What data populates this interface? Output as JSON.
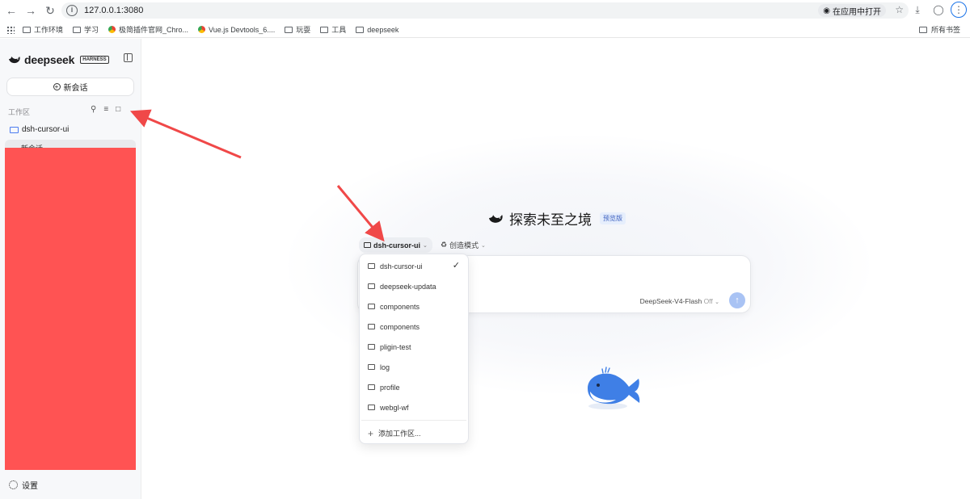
{
  "browser": {
    "url": "127.0.0.1:3080",
    "open_in_app": "在应用中打开",
    "bookmarks": [
      {
        "label": "工作环境",
        "icon": "folder-icon"
      },
      {
        "label": "学习",
        "icon": "folder-icon"
      },
      {
        "label": "极简插件官网_Chro...",
        "icon": "chrome-icon"
      },
      {
        "label": "Vue.js Devtools_6....",
        "icon": "chrome-icon"
      },
      {
        "label": "玩耍",
        "icon": "folder-icon"
      },
      {
        "label": "工具",
        "icon": "folder-icon"
      },
      {
        "label": "deepseek",
        "icon": "folder-icon"
      }
    ],
    "all_bookmarks": "所有书签"
  },
  "sidebar": {
    "logo_text": "deepseek",
    "logo_badge": "HARNESS",
    "new_chat": "新会话",
    "workspace_label": "工作区",
    "project": "dsh-cursor-ui",
    "thread": "新会话",
    "settings": "设置"
  },
  "main": {
    "headline": "探索未至之境",
    "beta_badge": "预览版",
    "workspace_chip": "dsh-cursor-ui",
    "mode_chip": "创造模式",
    "model": "DeepSeek-V4-Flash",
    "model_state": "Off",
    "send_icon": "arrow-up-icon"
  },
  "dropdown": {
    "items": [
      "dsh-cursor-ui",
      "deepseek-updata",
      "components",
      "components",
      "pligin-test",
      "log",
      "profile",
      "webgl-wf"
    ],
    "selected": "dsh-cursor-ui",
    "add_label": "添加工作区..."
  },
  "colors": {
    "accent_blue": "#4c7cf0",
    "send_button": "#a9c3f4",
    "redaction": "#ff5353",
    "annotation_arrow": "#f04848"
  }
}
